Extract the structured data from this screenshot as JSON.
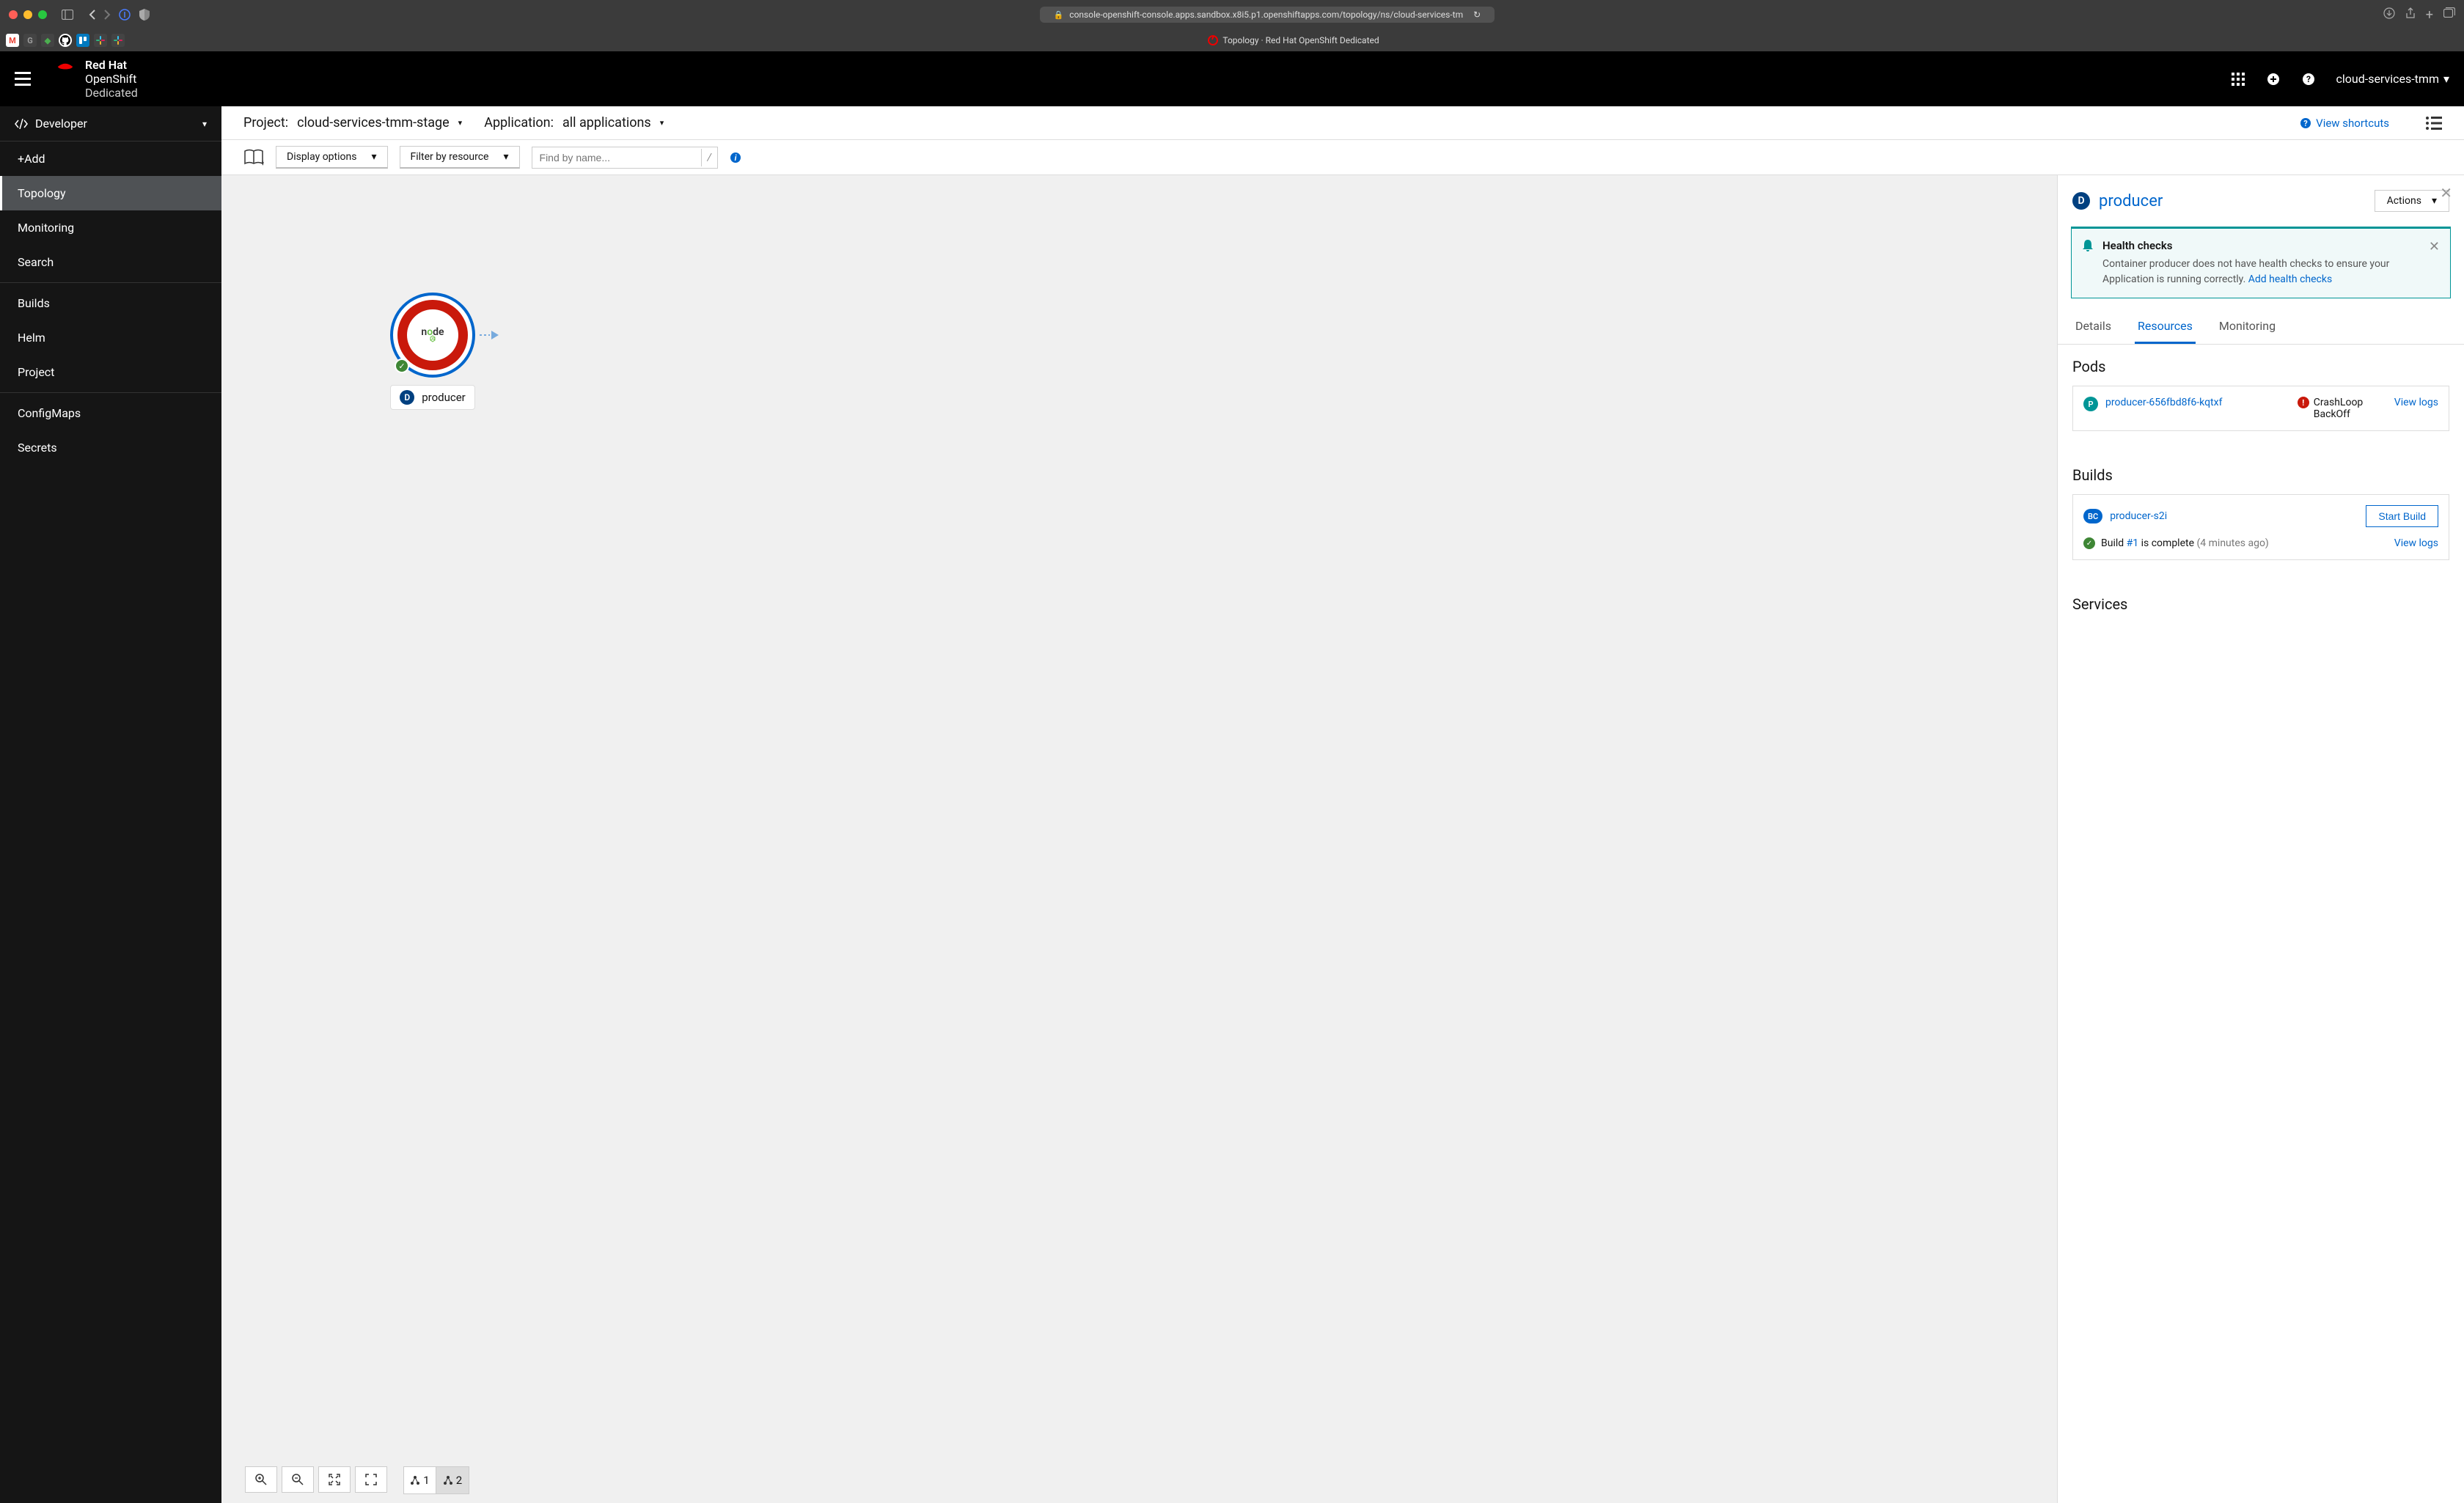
{
  "browser": {
    "url": "console-openshift-console.apps.sandbox.x8i5.p1.openshiftapps.com/topology/ns/cloud-services-tm",
    "page_title": "Topology · Red Hat OpenShift Dedicated"
  },
  "brand": {
    "line1": "Red Hat",
    "line2": "OpenShift",
    "line3": "Dedicated"
  },
  "header": {
    "user": "cloud-services-tmm"
  },
  "sidebar": {
    "perspective": "Developer",
    "items": [
      "+Add",
      "Topology",
      "Monitoring",
      "Search",
      "Builds",
      "Helm",
      "Project",
      "ConfigMaps",
      "Secrets"
    ],
    "active": "Topology"
  },
  "toolbar1": {
    "project_label": "Project:",
    "project_value": "cloud-services-tmm-stage",
    "application_label": "Application:",
    "application_value": "all applications",
    "shortcuts": "View shortcuts"
  },
  "toolbar2": {
    "display_options": "Display options",
    "filter": "Filter by resource",
    "search_placeholder": "Find by name...",
    "kbd": "/"
  },
  "node": {
    "name": "producer",
    "runtime": "node"
  },
  "canvas_controls": {
    "layout1": "1",
    "layout2": "2"
  },
  "panel": {
    "title": "producer",
    "actions": "Actions",
    "alert": {
      "title": "Health checks",
      "text": "Container producer does not have health checks to ensure your Application is running correctly.",
      "link": "Add health checks"
    },
    "tabs": [
      "Details",
      "Resources",
      "Monitoring"
    ],
    "active_tab": "Resources",
    "pods": {
      "heading": "Pods",
      "name": "producer-656fbd8f6-kqtxf",
      "status": "CrashLoop BackOff",
      "view_logs": "View logs"
    },
    "builds": {
      "heading": "Builds",
      "config": "producer-s2i",
      "start": "Start Build",
      "status_prefix": "Build",
      "build_num": "#1",
      "status_suffix": "is complete",
      "time": "(4 minutes ago)",
      "view_logs": "View logs"
    },
    "services": {
      "heading": "Services"
    }
  }
}
